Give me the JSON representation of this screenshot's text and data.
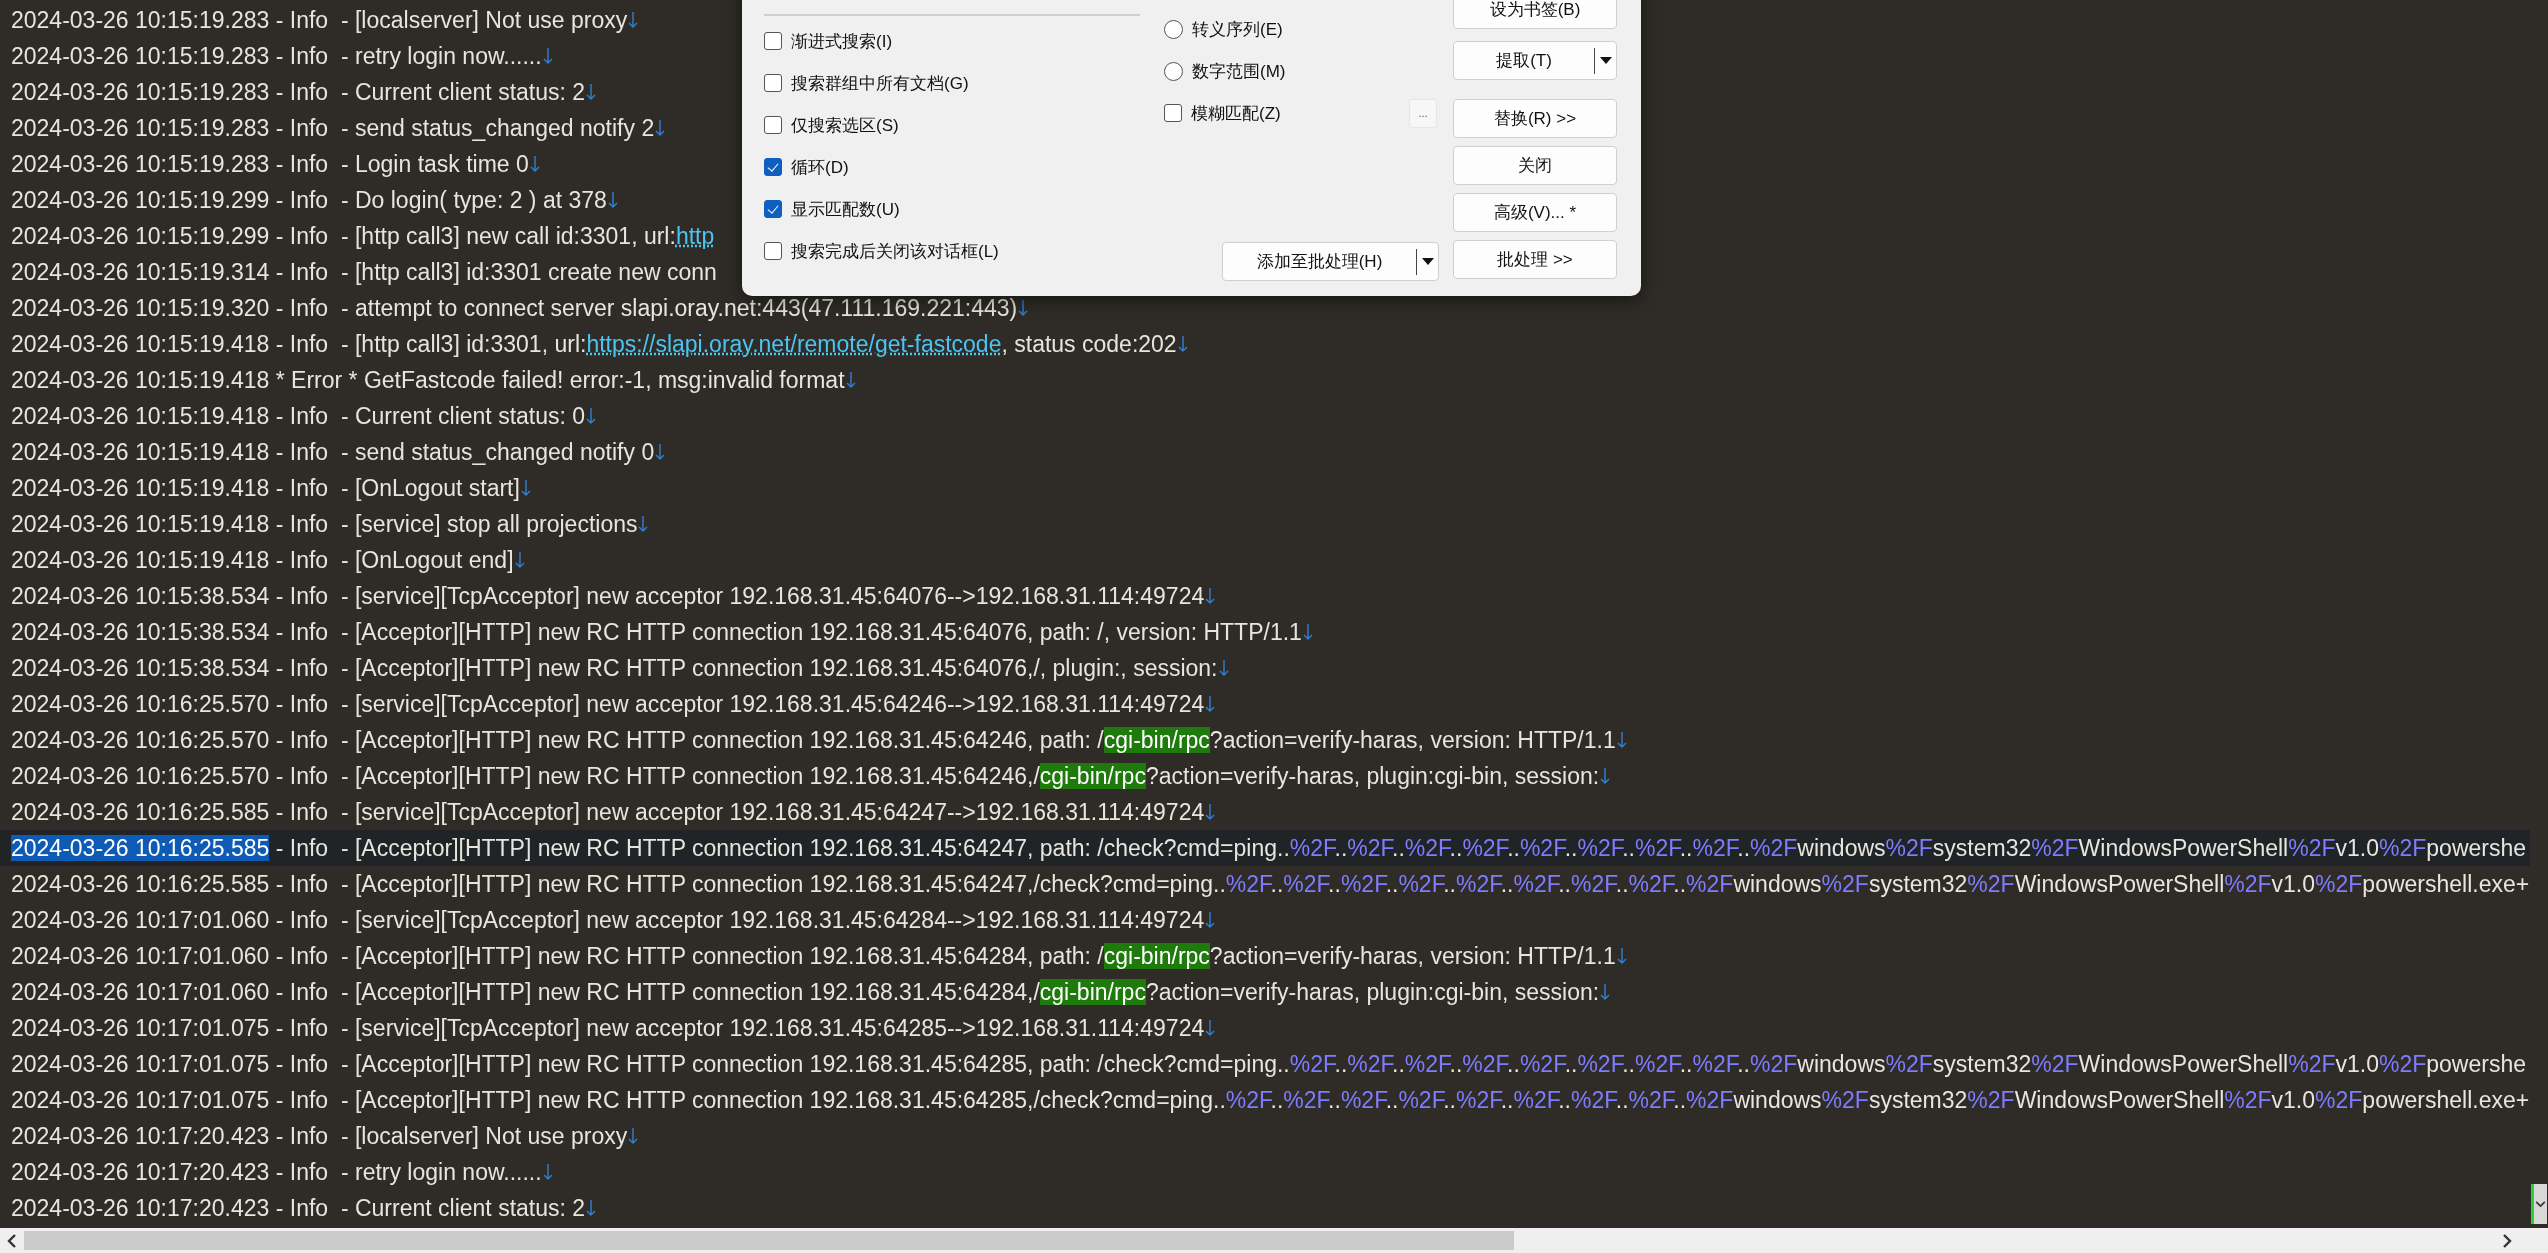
{
  "log": {
    "lines": [
      {
        "current": false,
        "eol": true,
        "segments": [
          {
            "kind": "text",
            "text": "2024-03-26 10:15:19.283 - Info  - [localserver] Not use proxy"
          }
        ]
      },
      {
        "current": false,
        "eol": true,
        "segments": [
          {
            "kind": "text",
            "text": "2024-03-26 10:15:19.283 - Info  - retry login now......"
          }
        ]
      },
      {
        "current": false,
        "eol": true,
        "segments": [
          {
            "kind": "text",
            "text": "2024-03-26 10:15:19.283 - Info  - Current client status: 2"
          }
        ]
      },
      {
        "current": false,
        "eol": true,
        "segments": [
          {
            "kind": "text",
            "text": "2024-03-26 10:15:19.283 - Info  - send status_changed notify 2"
          }
        ]
      },
      {
        "current": false,
        "eol": true,
        "segments": [
          {
            "kind": "text",
            "text": "2024-03-26 10:15:19.283 - Info  - Login task time 0"
          }
        ]
      },
      {
        "current": false,
        "eol": true,
        "segments": [
          {
            "kind": "text",
            "text": "2024-03-26 10:15:19.299 - Info  - Do login( type: 2 ) at 378"
          }
        ]
      },
      {
        "current": false,
        "eol": false,
        "segments": [
          {
            "kind": "text",
            "text": "2024-03-26 10:15:19.299 - Info  - [http call3] new call id:3301, url:"
          },
          {
            "kind": "link",
            "text": "http"
          }
        ]
      },
      {
        "current": false,
        "eol": false,
        "segments": [
          {
            "kind": "text",
            "text": "2024-03-26 10:15:19.314 - Info  - [http call3] id:3301 create new conn"
          }
        ]
      },
      {
        "current": false,
        "eol": true,
        "segments": [
          {
            "kind": "text",
            "text": "2024-03-26 10:15:19.320 - Info  - attempt to connect server slapi.oray.net:443(47.111.169.221:443)"
          }
        ]
      },
      {
        "current": false,
        "eol": true,
        "segments": [
          {
            "kind": "text",
            "text": "2024-03-26 10:15:19.418 - Info  - [http call3] id:3301, url:"
          },
          {
            "kind": "link",
            "text": "https://slapi.oray.net/remote/get-fastcode"
          },
          {
            "kind": "text",
            "text": ", status code:202"
          }
        ]
      },
      {
        "current": false,
        "eol": true,
        "segments": [
          {
            "kind": "text",
            "text": "2024-03-26 10:15:19.418 * Error * GetFastcode failed! error:-1, msg:invalid format"
          }
        ]
      },
      {
        "current": false,
        "eol": true,
        "segments": [
          {
            "kind": "text",
            "text": "2024-03-26 10:15:19.418 - Info  - Current client status: 0"
          }
        ]
      },
      {
        "current": false,
        "eol": true,
        "segments": [
          {
            "kind": "text",
            "text": "2024-03-26 10:15:19.418 - Info  - send status_changed notify 0"
          }
        ]
      },
      {
        "current": false,
        "eol": true,
        "segments": [
          {
            "kind": "text",
            "text": "2024-03-26 10:15:19.418 - Info  - [OnLogout start]"
          }
        ]
      },
      {
        "current": false,
        "eol": true,
        "segments": [
          {
            "kind": "text",
            "text": "2024-03-26 10:15:19.418 - Info  - [service] stop all projections"
          }
        ]
      },
      {
        "current": false,
        "eol": true,
        "segments": [
          {
            "kind": "text",
            "text": "2024-03-26 10:15:19.418 - Info  - [OnLogout end]"
          }
        ]
      },
      {
        "current": false,
        "eol": true,
        "segments": [
          {
            "kind": "text",
            "text": "2024-03-26 10:15:38.534 - Info  - [service][TcpAcceptor] new acceptor 192.168.31.45:64076-->192.168.31.114:49724"
          }
        ]
      },
      {
        "current": false,
        "eol": true,
        "segments": [
          {
            "kind": "text",
            "text": "2024-03-26 10:15:38.534 - Info  - [Acceptor][HTTP] new RC HTTP connection 192.168.31.45:64076, path: /, version: HTTP/1.1"
          }
        ]
      },
      {
        "current": false,
        "eol": true,
        "segments": [
          {
            "kind": "text",
            "text": "2024-03-26 10:15:38.534 - Info  - [Acceptor][HTTP] new RC HTTP connection 192.168.31.45:64076,/, plugin:, session:"
          }
        ]
      },
      {
        "current": false,
        "eol": true,
        "segments": [
          {
            "kind": "text",
            "text": "2024-03-26 10:16:25.570 - Info  - [service][TcpAcceptor] new acceptor 192.168.31.45:64246-->192.168.31.114:49724"
          }
        ]
      },
      {
        "current": false,
        "eol": true,
        "segments": [
          {
            "kind": "text",
            "text": "2024-03-26 10:16:25.570 - Info  - [Acceptor][HTTP] new RC HTTP connection 192.168.31.45:64246, path: /"
          },
          {
            "kind": "match",
            "text": "cgi-bin/rpc"
          },
          {
            "kind": "text",
            "text": "?action=verify-haras, version: HTTP/1.1"
          }
        ]
      },
      {
        "current": false,
        "eol": true,
        "segments": [
          {
            "kind": "text",
            "text": "2024-03-26 10:16:25.570 - Info  - [Acceptor][HTTP] new RC HTTP connection 192.168.31.45:64246,/"
          },
          {
            "kind": "match",
            "text": "cgi-bin/rpc"
          },
          {
            "kind": "text",
            "text": "?action=verify-haras, plugin:cgi-bin, session:"
          }
        ]
      },
      {
        "current": false,
        "eol": true,
        "segments": [
          {
            "kind": "text",
            "text": "2024-03-26 10:16:25.585 - Info  - [service][TcpAcceptor] new acceptor 192.168.31.45:64247-->192.168.31.114:49724"
          }
        ]
      },
      {
        "current": true,
        "eol": false,
        "segments": [
          {
            "kind": "selection",
            "text": "2024-03-26 10:16:25.585"
          },
          {
            "kind": "text",
            "text": " - Info  - [Acceptor][HTTP] new RC HTTP connection 192.168.31.45:64247, path: /check?cmd=ping.."
          },
          {
            "kind": "escape",
            "text": "%2F"
          },
          {
            "kind": "text",
            "text": ".."
          },
          {
            "kind": "escape",
            "text": "%2F"
          },
          {
            "kind": "text",
            "text": ".."
          },
          {
            "kind": "escape",
            "text": "%2F"
          },
          {
            "kind": "text",
            "text": ".."
          },
          {
            "kind": "escape",
            "text": "%2F"
          },
          {
            "kind": "text",
            "text": ".."
          },
          {
            "kind": "escape",
            "text": "%2F"
          },
          {
            "kind": "text",
            "text": ".."
          },
          {
            "kind": "escape",
            "text": "%2F"
          },
          {
            "kind": "text",
            "text": ".."
          },
          {
            "kind": "escape",
            "text": "%2F"
          },
          {
            "kind": "text",
            "text": ".."
          },
          {
            "kind": "escape",
            "text": "%2F"
          },
          {
            "kind": "text",
            "text": ".."
          },
          {
            "kind": "escape",
            "text": "%2F"
          },
          {
            "kind": "text",
            "text": "windows"
          },
          {
            "kind": "escape",
            "text": "%2F"
          },
          {
            "kind": "text",
            "text": "system32"
          },
          {
            "kind": "escape",
            "text": "%2F"
          },
          {
            "kind": "text",
            "text": "WindowsPowerShell"
          },
          {
            "kind": "escape",
            "text": "%2F"
          },
          {
            "kind": "text",
            "text": "v1.0"
          },
          {
            "kind": "escape",
            "text": "%2F"
          },
          {
            "kind": "text",
            "text": "powershe"
          }
        ]
      },
      {
        "current": false,
        "eol": false,
        "segments": [
          {
            "kind": "text",
            "text": "2024-03-26 10:16:25.585 - Info  - [Acceptor][HTTP] new RC HTTP connection 192.168.31.45:64247,/check?cmd=ping.."
          },
          {
            "kind": "escape",
            "text": "%2F"
          },
          {
            "kind": "text",
            "text": ".."
          },
          {
            "kind": "escape",
            "text": "%2F"
          },
          {
            "kind": "text",
            "text": ".."
          },
          {
            "kind": "escape",
            "text": "%2F"
          },
          {
            "kind": "text",
            "text": ".."
          },
          {
            "kind": "escape",
            "text": "%2F"
          },
          {
            "kind": "text",
            "text": ".."
          },
          {
            "kind": "escape",
            "text": "%2F"
          },
          {
            "kind": "text",
            "text": ".."
          },
          {
            "kind": "escape",
            "text": "%2F"
          },
          {
            "kind": "text",
            "text": ".."
          },
          {
            "kind": "escape",
            "text": "%2F"
          },
          {
            "kind": "text",
            "text": ".."
          },
          {
            "kind": "escape",
            "text": "%2F"
          },
          {
            "kind": "text",
            "text": ".."
          },
          {
            "kind": "escape",
            "text": "%2F"
          },
          {
            "kind": "text",
            "text": "windows"
          },
          {
            "kind": "escape",
            "text": "%2F"
          },
          {
            "kind": "text",
            "text": "system32"
          },
          {
            "kind": "escape",
            "text": "%2F"
          },
          {
            "kind": "text",
            "text": "WindowsPowerShell"
          },
          {
            "kind": "escape",
            "text": "%2F"
          },
          {
            "kind": "text",
            "text": "v1.0"
          },
          {
            "kind": "escape",
            "text": "%2F"
          },
          {
            "kind": "text",
            "text": "powershell.exe+"
          }
        ]
      },
      {
        "current": false,
        "eol": true,
        "segments": [
          {
            "kind": "text",
            "text": "2024-03-26 10:17:01.060 - Info  - [service][TcpAcceptor] new acceptor 192.168.31.45:64284-->192.168.31.114:49724"
          }
        ]
      },
      {
        "current": false,
        "eol": true,
        "segments": [
          {
            "kind": "text",
            "text": "2024-03-26 10:17:01.060 - Info  - [Acceptor][HTTP] new RC HTTP connection 192.168.31.45:64284, path: /"
          },
          {
            "kind": "match",
            "text": "cgi-bin/rpc"
          },
          {
            "kind": "text",
            "text": "?action=verify-haras, version: HTTP/1.1"
          }
        ]
      },
      {
        "current": false,
        "eol": true,
        "segments": [
          {
            "kind": "text",
            "text": "2024-03-26 10:17:01.060 - Info  - [Acceptor][HTTP] new RC HTTP connection 192.168.31.45:64284,/"
          },
          {
            "kind": "match",
            "text": "cgi-bin/rpc"
          },
          {
            "kind": "text",
            "text": "?action=verify-haras, plugin:cgi-bin, session:"
          }
        ]
      },
      {
        "current": false,
        "eol": true,
        "segments": [
          {
            "kind": "text",
            "text": "2024-03-26 10:17:01.075 - Info  - [service][TcpAcceptor] new acceptor 192.168.31.45:64285-->192.168.31.114:49724"
          }
        ]
      },
      {
        "current": false,
        "eol": false,
        "segments": [
          {
            "kind": "text",
            "text": "2024-03-26 10:17:01.075 - Info  - [Acceptor][HTTP] new RC HTTP connection 192.168.31.45:64285, path: /check?cmd=ping.."
          },
          {
            "kind": "escape",
            "text": "%2F"
          },
          {
            "kind": "text",
            "text": ".."
          },
          {
            "kind": "escape",
            "text": "%2F"
          },
          {
            "kind": "text",
            "text": ".."
          },
          {
            "kind": "escape",
            "text": "%2F"
          },
          {
            "kind": "text",
            "text": ".."
          },
          {
            "kind": "escape",
            "text": "%2F"
          },
          {
            "kind": "text",
            "text": ".."
          },
          {
            "kind": "escape",
            "text": "%2F"
          },
          {
            "kind": "text",
            "text": ".."
          },
          {
            "kind": "escape",
            "text": "%2F"
          },
          {
            "kind": "text",
            "text": ".."
          },
          {
            "kind": "escape",
            "text": "%2F"
          },
          {
            "kind": "text",
            "text": ".."
          },
          {
            "kind": "escape",
            "text": "%2F"
          },
          {
            "kind": "text",
            "text": ".."
          },
          {
            "kind": "escape",
            "text": "%2F"
          },
          {
            "kind": "text",
            "text": "windows"
          },
          {
            "kind": "escape",
            "text": "%2F"
          },
          {
            "kind": "text",
            "text": "system32"
          },
          {
            "kind": "escape",
            "text": "%2F"
          },
          {
            "kind": "text",
            "text": "WindowsPowerShell"
          },
          {
            "kind": "escape",
            "text": "%2F"
          },
          {
            "kind": "text",
            "text": "v1.0"
          },
          {
            "kind": "escape",
            "text": "%2F"
          },
          {
            "kind": "text",
            "text": "powershe"
          }
        ]
      },
      {
        "current": false,
        "eol": false,
        "segments": [
          {
            "kind": "text",
            "text": "2024-03-26 10:17:01.075 - Info  - [Acceptor][HTTP] new RC HTTP connection 192.168.31.45:64285,/check?cmd=ping.."
          },
          {
            "kind": "escape",
            "text": "%2F"
          },
          {
            "kind": "text",
            "text": ".."
          },
          {
            "kind": "escape",
            "text": "%2F"
          },
          {
            "kind": "text",
            "text": ".."
          },
          {
            "kind": "escape",
            "text": "%2F"
          },
          {
            "kind": "text",
            "text": ".."
          },
          {
            "kind": "escape",
            "text": "%2F"
          },
          {
            "kind": "text",
            "text": ".."
          },
          {
            "kind": "escape",
            "text": "%2F"
          },
          {
            "kind": "text",
            "text": ".."
          },
          {
            "kind": "escape",
            "text": "%2F"
          },
          {
            "kind": "text",
            "text": ".."
          },
          {
            "kind": "escape",
            "text": "%2F"
          },
          {
            "kind": "text",
            "text": ".."
          },
          {
            "kind": "escape",
            "text": "%2F"
          },
          {
            "kind": "text",
            "text": ".."
          },
          {
            "kind": "escape",
            "text": "%2F"
          },
          {
            "kind": "text",
            "text": "windows"
          },
          {
            "kind": "escape",
            "text": "%2F"
          },
          {
            "kind": "text",
            "text": "system32"
          },
          {
            "kind": "escape",
            "text": "%2F"
          },
          {
            "kind": "text",
            "text": "WindowsPowerShell"
          },
          {
            "kind": "escape",
            "text": "%2F"
          },
          {
            "kind": "text",
            "text": "v1.0"
          },
          {
            "kind": "escape",
            "text": "%2F"
          },
          {
            "kind": "text",
            "text": "powershell.exe+"
          }
        ]
      },
      {
        "current": false,
        "eol": true,
        "segments": [
          {
            "kind": "text",
            "text": "2024-03-26 10:17:20.423 - Info  - [localserver] Not use proxy"
          }
        ]
      },
      {
        "current": false,
        "eol": true,
        "segments": [
          {
            "kind": "text",
            "text": "2024-03-26 10:17:20.423 - Info  - retry login now......"
          }
        ]
      },
      {
        "current": false,
        "eol": true,
        "segments": [
          {
            "kind": "text",
            "text": "2024-03-26 10:17:20.423 - Info  - Current client status: 2"
          }
        ]
      }
    ]
  },
  "find_dialog": {
    "options": [
      {
        "label": "渐进式搜索(I)",
        "checked": false
      },
      {
        "label": "搜索群组中所有文档(G)",
        "checked": false
      },
      {
        "label": "仅搜索选区(S)",
        "checked": false
      },
      {
        "label": "循环(D)",
        "checked": true
      },
      {
        "label": "显示匹配数(U)",
        "checked": true
      },
      {
        "label": "搜索完成后关闭该对话框(L)",
        "checked": false
      }
    ],
    "modes": [
      {
        "kind": "radio",
        "label": "转义序列(E)",
        "selected": false
      },
      {
        "kind": "radio",
        "label": "数字范围(M)",
        "selected": false
      },
      {
        "kind": "checkbox",
        "label": "模糊匹配(Z)",
        "checked": false
      }
    ],
    "more_button": "...",
    "batch_add_button": "添加至批处理(H)",
    "buttons": [
      {
        "label": "设为书签(B)",
        "dropdown": false
      },
      {
        "label": "提取(T)",
        "dropdown": true
      },
      {
        "label": "替换(R) >>",
        "dropdown": false
      },
      {
        "label": "关闭",
        "dropdown": false
      },
      {
        "label": "高级(V)... *",
        "dropdown": false
      },
      {
        "label": "批处理 >>",
        "dropdown": false
      }
    ]
  }
}
